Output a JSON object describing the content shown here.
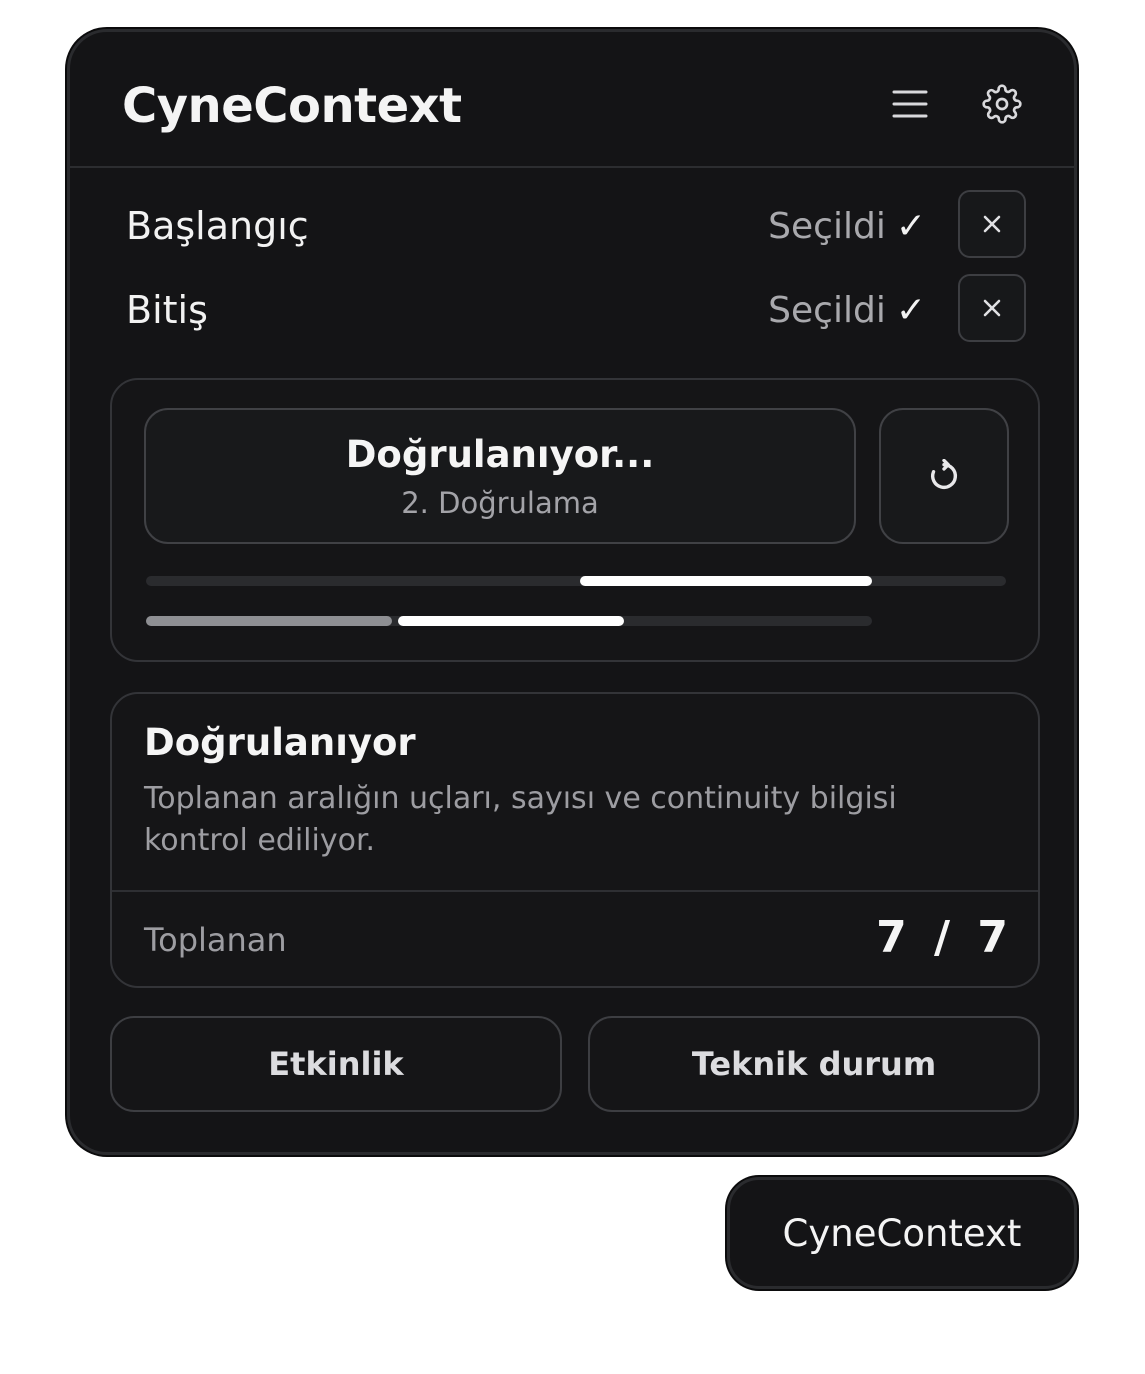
{
  "header": {
    "title": "CyneContext",
    "menu_icon": "hamburger-menu-icon",
    "settings_icon": "gear-icon"
  },
  "selection": {
    "start": {
      "label": "Başlangıç",
      "status": "Seçildi",
      "check": "✓",
      "clear_icon": "close-icon"
    },
    "end": {
      "label": "Bitiş",
      "status": "Seçildi",
      "check": "✓",
      "clear_icon": "close-icon"
    }
  },
  "verify": {
    "title": "Doğrulanıyor...",
    "subtitle": "2. Doğrulama",
    "refresh_icon": "refresh-icon"
  },
  "info": {
    "title": "Doğrulanıyor",
    "description": "Toplanan aralığın uçları, sayısı ve continuity bilgisi kontrol ediliyor.",
    "count_label": "Toplanan",
    "count_value": "7 / 7"
  },
  "actions": {
    "activity_label": "Etkinlik",
    "technical_label": "Teknik durum"
  },
  "launcher": {
    "label": "CyneContext"
  },
  "colors": {
    "panel_bg": "#141416",
    "border": "#333438",
    "text_primary": "#f5f5f5",
    "text_muted": "#9d9da2",
    "bar_active": "#ffffff",
    "bar_done": "#8e8f93",
    "bar_track": "#2c2d30"
  }
}
